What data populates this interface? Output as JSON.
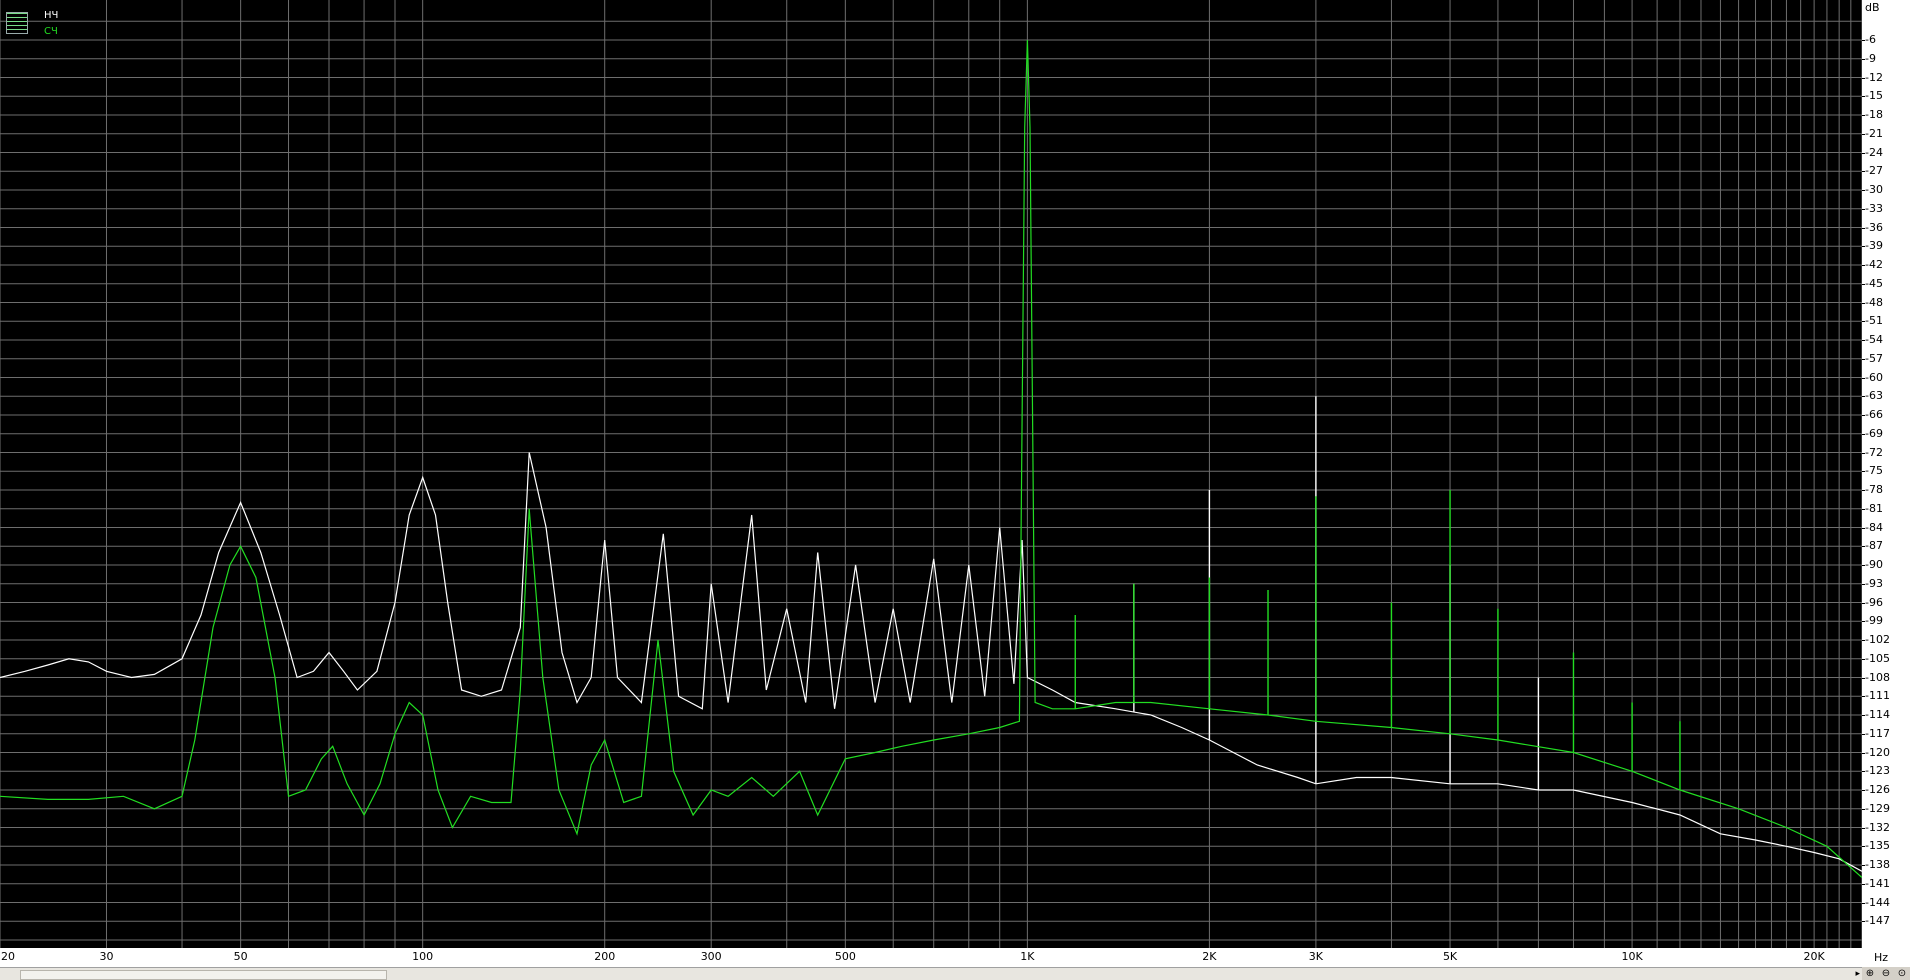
{
  "legend": {
    "items": [
      {
        "label": "НЧ",
        "color": "#ffffff"
      },
      {
        "label": "СЧ",
        "color": "#22dd22"
      }
    ]
  },
  "y_unit": "dB",
  "x_unit": "Hz",
  "icons": {
    "zoom_in": "zoom-in-icon",
    "zoom_out": "zoom-out-icon",
    "zoom_fit": "zoom-fit-icon",
    "scroll_right": "scroll-right-arrow-icon"
  },
  "colors": {
    "background": "#000000",
    "grid": "#6e6e6e",
    "series_1": "#ffffff",
    "series_2": "#22dd22"
  },
  "chart_data": {
    "type": "line",
    "xscale": "log",
    "xlim": [
      20,
      24000
    ],
    "ylim": [
      -150,
      -3
    ],
    "grid": true,
    "legend_position": "top-left",
    "y_ticks": [
      -6,
      -9,
      -12,
      -15,
      -18,
      -21,
      -24,
      -27,
      -30,
      -33,
      -36,
      -39,
      -42,
      -45,
      -48,
      -51,
      -54,
      -57,
      -60,
      -63,
      -66,
      -69,
      -72,
      -75,
      -78,
      -81,
      -84,
      -87,
      -90,
      -93,
      -96,
      -99,
      -102,
      -105,
      -108,
      -111,
      -114,
      -117,
      -120,
      -123,
      -126,
      -129,
      -132,
      -135,
      -138,
      -141,
      -144,
      -147
    ],
    "x_ticks": [
      {
        "value": 20,
        "label": "20"
      },
      {
        "value": 30,
        "label": "30"
      },
      {
        "value": 50,
        "label": "50"
      },
      {
        "value": 100,
        "label": "100"
      },
      {
        "value": 200,
        "label": "200"
      },
      {
        "value": 300,
        "label": "300"
      },
      {
        "value": 500,
        "label": "500"
      },
      {
        "value": 1000,
        "label": "1K"
      },
      {
        "value": 2000,
        "label": "2K"
      },
      {
        "value": 3000,
        "label": "3K"
      },
      {
        "value": 5000,
        "label": "5K"
      },
      {
        "value": 10000,
        "label": "10K"
      },
      {
        "value": 20000,
        "label": "20K"
      }
    ],
    "series": [
      {
        "name": "НЧ",
        "color": "#ffffff",
        "points": [
          [
            20,
            -108
          ],
          [
            22,
            -107
          ],
          [
            24,
            -106
          ],
          [
            26,
            -105
          ],
          [
            28,
            -105.5
          ],
          [
            30,
            -107
          ],
          [
            33,
            -108
          ],
          [
            36,
            -107.5
          ],
          [
            40,
            -105
          ],
          [
            43,
            -98
          ],
          [
            46,
            -88
          ],
          [
            50,
            -80
          ],
          [
            54,
            -88
          ],
          [
            58,
            -98
          ],
          [
            62,
            -108
          ],
          [
            66,
            -107
          ],
          [
            70,
            -104
          ],
          [
            74,
            -107
          ],
          [
            78,
            -110
          ],
          [
            84,
            -107
          ],
          [
            90,
            -96
          ],
          [
            95,
            -82
          ],
          [
            100,
            -76
          ],
          [
            105,
            -82
          ],
          [
            110,
            -96
          ],
          [
            116,
            -110
          ],
          [
            125,
            -111
          ],
          [
            135,
            -110
          ],
          [
            145,
            -100
          ],
          [
            150,
            -72
          ],
          [
            160,
            -84
          ],
          [
            170,
            -104
          ],
          [
            180,
            -112
          ],
          [
            190,
            -108
          ],
          [
            200,
            -86
          ],
          [
            210,
            -108
          ],
          [
            230,
            -112
          ],
          [
            250,
            -85
          ],
          [
            265,
            -111
          ],
          [
            290,
            -113
          ],
          [
            300,
            -93
          ],
          [
            320,
            -112
          ],
          [
            350,
            -82
          ],
          [
            370,
            -110
          ],
          [
            400,
            -97
          ],
          [
            430,
            -112
          ],
          [
            450,
            -88
          ],
          [
            480,
            -113
          ],
          [
            520,
            -90
          ],
          [
            560,
            -112
          ],
          [
            600,
            -97
          ],
          [
            640,
            -112
          ],
          [
            700,
            -89
          ],
          [
            750,
            -112
          ],
          [
            800,
            -90
          ],
          [
            850,
            -111
          ],
          [
            900,
            -84
          ],
          [
            950,
            -109
          ],
          [
            980,
            -86
          ],
          [
            1000,
            -108
          ],
          [
            1100,
            -110
          ],
          [
            1200,
            -112
          ],
          [
            1400,
            -113
          ],
          [
            1600,
            -114
          ],
          [
            1800,
            -116
          ],
          [
            2000,
            -118
          ],
          [
            2400,
            -122
          ],
          [
            2800,
            -124
          ],
          [
            3000,
            -125
          ],
          [
            3500,
            -124
          ],
          [
            4000,
            -124
          ],
          [
            5000,
            -125
          ],
          [
            6000,
            -125
          ],
          [
            7000,
            -126
          ],
          [
            8000,
            -126
          ],
          [
            10000,
            -128
          ],
          [
            12000,
            -130
          ],
          [
            14000,
            -133
          ],
          [
            16000,
            -134
          ],
          [
            18000,
            -135
          ],
          [
            20000,
            -136
          ],
          [
            22000,
            -137
          ],
          [
            24000,
            -139
          ]
        ],
        "peaks": [
          [
            1500,
            -93
          ],
          [
            2000,
            -78
          ],
          [
            3000,
            -63
          ],
          [
            5000,
            -90
          ],
          [
            7000,
            -108
          ]
        ]
      },
      {
        "name": "СЧ",
        "color": "#22dd22",
        "points": [
          [
            20,
            -127
          ],
          [
            24,
            -127.5
          ],
          [
            28,
            -127.5
          ],
          [
            32,
            -127
          ],
          [
            36,
            -129
          ],
          [
            40,
            -127
          ],
          [
            42,
            -118
          ],
          [
            45,
            -100
          ],
          [
            48,
            -90
          ],
          [
            50,
            -87
          ],
          [
            53,
            -92
          ],
          [
            57,
            -108
          ],
          [
            60,
            -127
          ],
          [
            64,
            -126
          ],
          [
            68,
            -121
          ],
          [
            71,
            -119
          ],
          [
            75,
            -125
          ],
          [
            80,
            -130
          ],
          [
            85,
            -125
          ],
          [
            90,
            -117
          ],
          [
            95,
            -112
          ],
          [
            100,
            -114
          ],
          [
            106,
            -126
          ],
          [
            112,
            -132
          ],
          [
            120,
            -127
          ],
          [
            130,
            -128
          ],
          [
            140,
            -128
          ],
          [
            145,
            -110
          ],
          [
            150,
            -81
          ],
          [
            158,
            -108
          ],
          [
            168,
            -126
          ],
          [
            180,
            -133
          ],
          [
            190,
            -122
          ],
          [
            200,
            -118
          ],
          [
            215,
            -128
          ],
          [
            230,
            -127
          ],
          [
            245,
            -102
          ],
          [
            260,
            -123
          ],
          [
            280,
            -130
          ],
          [
            300,
            -126
          ],
          [
            320,
            -127
          ],
          [
            350,
            -124
          ],
          [
            380,
            -127
          ],
          [
            420,
            -123
          ],
          [
            450,
            -130
          ],
          [
            500,
            -121
          ],
          [
            560,
            -120
          ],
          [
            620,
            -119
          ],
          [
            700,
            -118
          ],
          [
            800,
            -117
          ],
          [
            900,
            -116
          ],
          [
            970,
            -115
          ],
          [
            990,
            -20
          ],
          [
            1000,
            -6
          ],
          [
            1010,
            -20
          ],
          [
            1030,
            -112
          ],
          [
            1100,
            -113
          ],
          [
            1200,
            -113
          ],
          [
            1400,
            -112
          ],
          [
            1600,
            -112
          ],
          [
            2000,
            -113
          ],
          [
            2500,
            -114
          ],
          [
            3000,
            -115
          ],
          [
            4000,
            -116
          ],
          [
            5000,
            -117
          ],
          [
            6000,
            -118
          ],
          [
            8000,
            -120
          ],
          [
            10000,
            -123
          ],
          [
            12000,
            -126
          ],
          [
            15000,
            -129
          ],
          [
            18000,
            -132
          ],
          [
            21000,
            -135
          ],
          [
            24000,
            -140
          ]
        ],
        "peaks": [
          [
            1200,
            -98
          ],
          [
            1500,
            -93
          ],
          [
            2000,
            -92
          ],
          [
            2500,
            -94
          ],
          [
            3000,
            -79
          ],
          [
            4000,
            -96
          ],
          [
            5000,
            -78
          ],
          [
            6000,
            -97
          ],
          [
            8000,
            -104
          ],
          [
            10000,
            -112
          ],
          [
            12000,
            -115
          ]
        ]
      }
    ]
  }
}
